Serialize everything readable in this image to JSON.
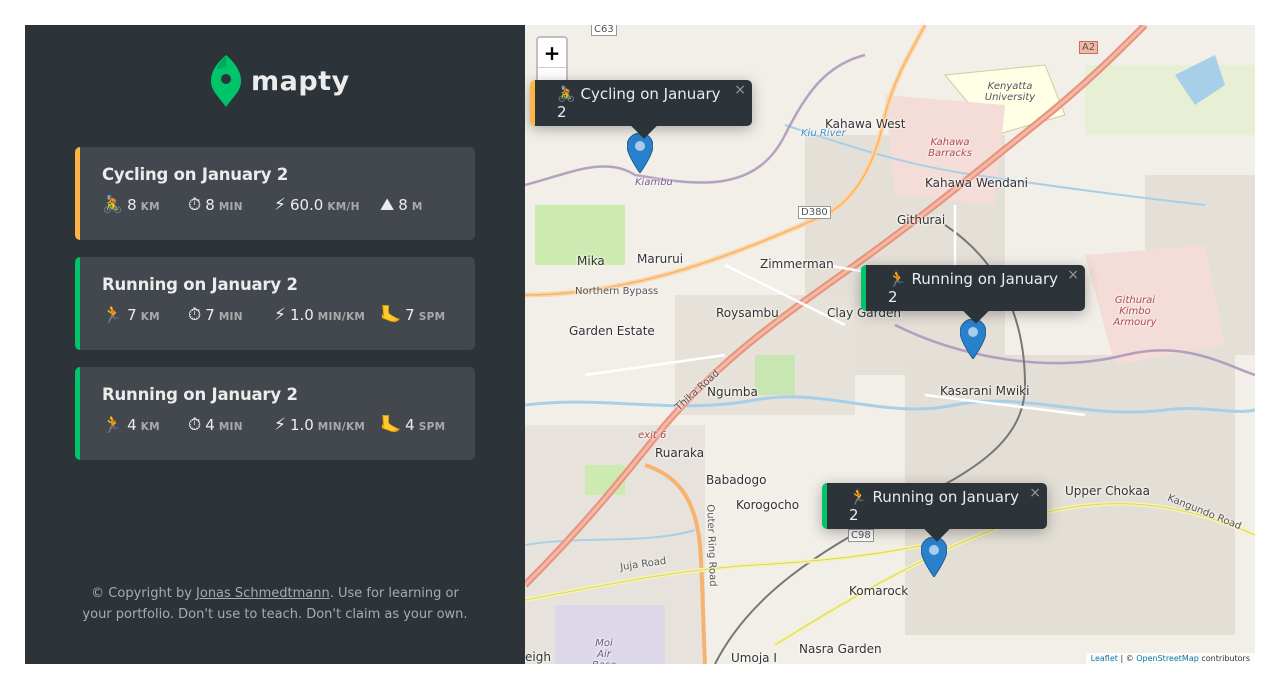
{
  "brand": {
    "name": "mapty"
  },
  "workouts": [
    {
      "type": "cycling",
      "title": "Cycling on January 2",
      "distance": {
        "icon": "🚴",
        "value": "8",
        "unit": "km"
      },
      "duration": {
        "icon": "⏱",
        "value": "8",
        "unit": "min"
      },
      "speed": {
        "icon": "⚡",
        "value": "60.0",
        "unit": "km/h"
      },
      "extra": {
        "icon": "⛰",
        "value": "8",
        "unit": "m"
      }
    },
    {
      "type": "running",
      "title": "Running on January 2",
      "distance": {
        "icon": "🏃",
        "value": "7",
        "unit": "km"
      },
      "duration": {
        "icon": "⏱",
        "value": "7",
        "unit": "min"
      },
      "speed": {
        "icon": "⚡",
        "value": "1.0",
        "unit": "min/km"
      },
      "extra": {
        "icon": "🦶",
        "value": "7",
        "unit": "spm"
      }
    },
    {
      "type": "running",
      "title": "Running on January 2",
      "distance": {
        "icon": "🏃",
        "value": "4",
        "unit": "km"
      },
      "duration": {
        "icon": "⏱",
        "value": "4",
        "unit": "min"
      },
      "speed": {
        "icon": "⚡",
        "value": "1.0",
        "unit": "min/km"
      },
      "extra": {
        "icon": "🦶",
        "value": "4",
        "unit": "spm"
      }
    }
  ],
  "copyright": {
    "prefix": "© Copyright by ",
    "author": "Jonas Schmedtmann",
    "suffix": ". Use for learning or your portfolio. Don't use to teach. Don't claim as your own."
  },
  "map": {
    "zoom_in": "+",
    "zoom_out": "−",
    "popups": [
      {
        "icon": "🚴",
        "text": "Cycling on January 2",
        "close": "×"
      },
      {
        "icon": "🏃",
        "text": "Running on January 2",
        "close": "×"
      },
      {
        "icon": "🏃",
        "text": "Running on January 2",
        "close": "×"
      }
    ],
    "labels": {
      "kahawa_west": "Kahawa West",
      "kahawa_wendani": "Kahawa Wendani",
      "kahawa_barracks": "Kahawa Barracks",
      "kenyatta": "Kenyatta University",
      "githurai": "Githurai",
      "githurai_armoury": "Githurai Kimbo Armoury",
      "mika": "Mika",
      "marurui": "Marurui",
      "zimmerman": "Zimmerman",
      "roysambu": "Roysambu",
      "clay": "Clay Garden",
      "garden_estate": "Garden Estate",
      "kasarani": "Kasarani Mwiki",
      "ngumba": "Ngumba",
      "ruaraka": "Ruaraka",
      "babadogo": "Babadogo",
      "korogocho": "Korogocho",
      "upper_chokaa": "Upper Chokaa",
      "komarock": "Komarock",
      "nasra": "Nasra Garden",
      "umoja": "Umoja I",
      "eigh": "eigh",
      "moi_air": "Moi Air Base",
      "kiambu": "Kiambu",
      "kiu_river": "Kiu River",
      "northern_bypass": "Northern Bypass",
      "thika_road": "Thika Road",
      "outer_ring": "Outer Ring Road",
      "juja_road": "Juja Road",
      "kangundo": "Kangundo Road",
      "d380": "D380",
      "c63": "C63",
      "c98": "C98",
      "a2": "A2",
      "exit6": "exit 6"
    },
    "attribution": {
      "leaflet": "Leaflet",
      "sep": " | © ",
      "osm": "OpenStreetMap",
      "rest": " contributors"
    }
  }
}
